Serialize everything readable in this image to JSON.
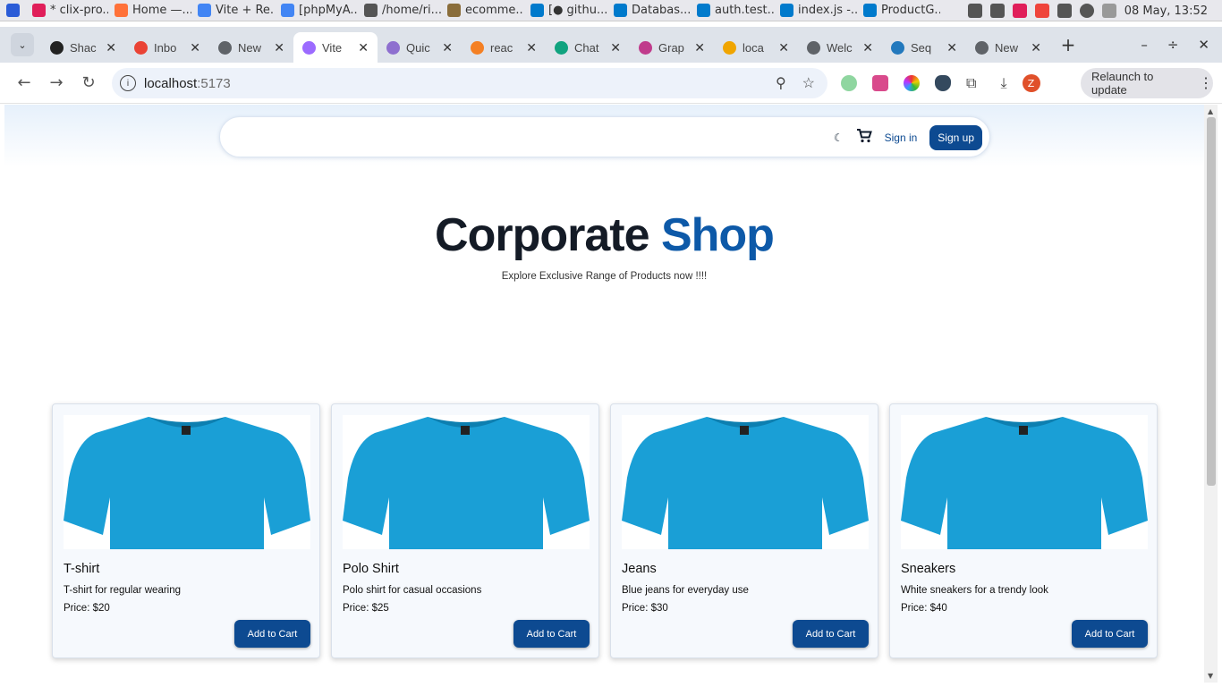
{
  "taskbar": {
    "items": [
      {
        "label": "* clix-pro...",
        "icon": "slack-icon",
        "color": "#e01e5a"
      },
      {
        "label": "Home —...",
        "icon": "firefox-icon",
        "color": "#ff7139"
      },
      {
        "label": "Vite + Re...",
        "icon": "chrome-icon",
        "color": "#4285f4"
      },
      {
        "label": "[phpMyA...",
        "icon": "chrome-icon",
        "color": "#4285f4"
      },
      {
        "label": "/home/ri...",
        "icon": "text-editor-icon",
        "color": "#555555"
      },
      {
        "label": "ecomme...",
        "icon": "folder-icon",
        "color": "#8a6d3b"
      },
      {
        "label": "[● githu...",
        "icon": "vscode-icon",
        "color": "#007acc"
      },
      {
        "label": "Databas...",
        "icon": "vscode-icon",
        "color": "#007acc"
      },
      {
        "label": "auth.test...",
        "icon": "vscode-icon",
        "color": "#007acc"
      },
      {
        "label": "index.js -...",
        "icon": "vscode-icon",
        "color": "#007acc"
      },
      {
        "label": "ProductG...",
        "icon": "vscode-icon",
        "color": "#007acc"
      }
    ],
    "clock": "08 May, 13:52"
  },
  "tabs": [
    {
      "label": "Shac",
      "icon": "github-icon",
      "color": "#222222"
    },
    {
      "label": "Inbo",
      "icon": "gmail-icon",
      "color": "#ea4335"
    },
    {
      "label": "New",
      "icon": "chrome-icon",
      "color": "#5f6368"
    },
    {
      "label": "Vite",
      "icon": "vite-icon",
      "color": "#9c6bff",
      "active": true
    },
    {
      "label": "Quic",
      "icon": "graphql-icon",
      "color": "#8e6fcf"
    },
    {
      "label": "reac",
      "icon": "stackoverflow-icon",
      "color": "#f48024"
    },
    {
      "label": "Chat",
      "icon": "chatgpt-icon",
      "color": "#10a37f"
    },
    {
      "label": "Grap",
      "icon": "grafbase-icon",
      "color": "#c03c8c"
    },
    {
      "label": "loca",
      "icon": "phpmyadmin-icon",
      "color": "#f0a500"
    },
    {
      "label": "Welc",
      "icon": "globe-icon",
      "color": "#5f6368"
    },
    {
      "label": "Seq",
      "icon": "sequelize-icon",
      "color": "#2379bd"
    },
    {
      "label": "New",
      "icon": "chrome-icon",
      "color": "#5f6368"
    }
  ],
  "address": {
    "host": "localhost",
    "port": ":5173"
  },
  "toolbar": {
    "relaunch_label": "Relaunch to update",
    "avatar_letter": "Z"
  },
  "navbar": {
    "signin_label": "Sign in",
    "signup_label": "Sign up"
  },
  "hero": {
    "title_main": "Corporate",
    "title_accent": "Shop",
    "subtitle": "Explore Exclusive Range of Products now !!!!"
  },
  "products": [
    {
      "name": "T-shirt",
      "description": "T-shirt for regular wearing",
      "price": "Price: $20",
      "button": "Add to Cart"
    },
    {
      "name": "Polo Shirt",
      "description": "Polo shirt for casual occasions",
      "price": "Price: $25",
      "button": "Add to Cart"
    },
    {
      "name": "Jeans",
      "description": "Blue jeans for everyday use",
      "price": "Price: $30",
      "button": "Add to Cart"
    },
    {
      "name": "Sneakers",
      "description": "White sneakers for a trendy look",
      "price": "Price: $40",
      "button": "Add to Cart"
    }
  ],
  "colors": {
    "brand": "#0d4a91",
    "accent": "#0d59a8",
    "shirt": "#1a9fd6"
  }
}
